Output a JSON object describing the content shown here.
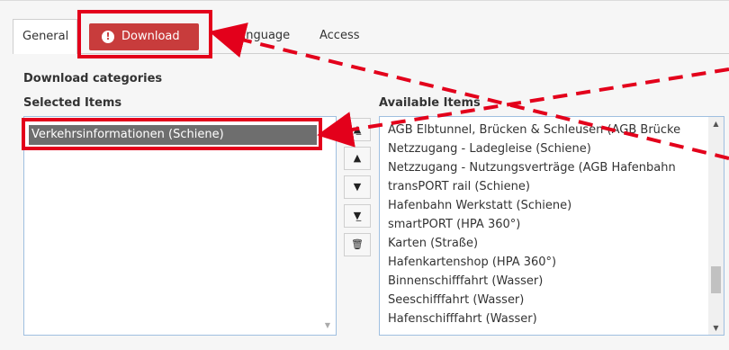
{
  "tabs": [
    {
      "label": "General"
    },
    {
      "label": "Download"
    },
    {
      "label": "Language"
    },
    {
      "label": "Access"
    }
  ],
  "tab_alert_icon": "exclamation-circle-icon",
  "section_title": "Download categories",
  "selected_label": "Selected Items",
  "available_label": "Available Items",
  "selected_items": [
    "Verkehrsinformationen (Schiene)"
  ],
  "available_items": [
    "AGB Elbtunnel, Brücken & Schleusen (AGB Brücke",
    "Netzzugang - Ladegleise (Schiene)",
    "Netzzugang - Nutzungsverträge (AGB Hafenbahn",
    "transPORT rail (Schiene)",
    "Hafenbahn Werkstatt (Schiene)",
    "smartPORT (HPA 360°)",
    "Karten (Straße)",
    "Hafenkartenshop (HPA 360°)",
    "Binnenschifffahrt (Wasser)",
    "Seeschifffahrt (Wasser)",
    "Hafenschifffahrt (Wasser)"
  ],
  "controls": [
    {
      "icon": "move-to-top-icon",
      "glyph": "⏶"
    },
    {
      "icon": "move-up-icon",
      "glyph": "▲"
    },
    {
      "icon": "move-down-icon",
      "glyph": "▼"
    },
    {
      "icon": "move-to-bottom-icon",
      "glyph": "⏷"
    },
    {
      "icon": "trash-icon",
      "glyph": "🗑"
    }
  ],
  "colors": {
    "alert_tab": "#c83c3c",
    "highlight": "#e3001b",
    "selected_item_bg": "#6e6e6e"
  }
}
